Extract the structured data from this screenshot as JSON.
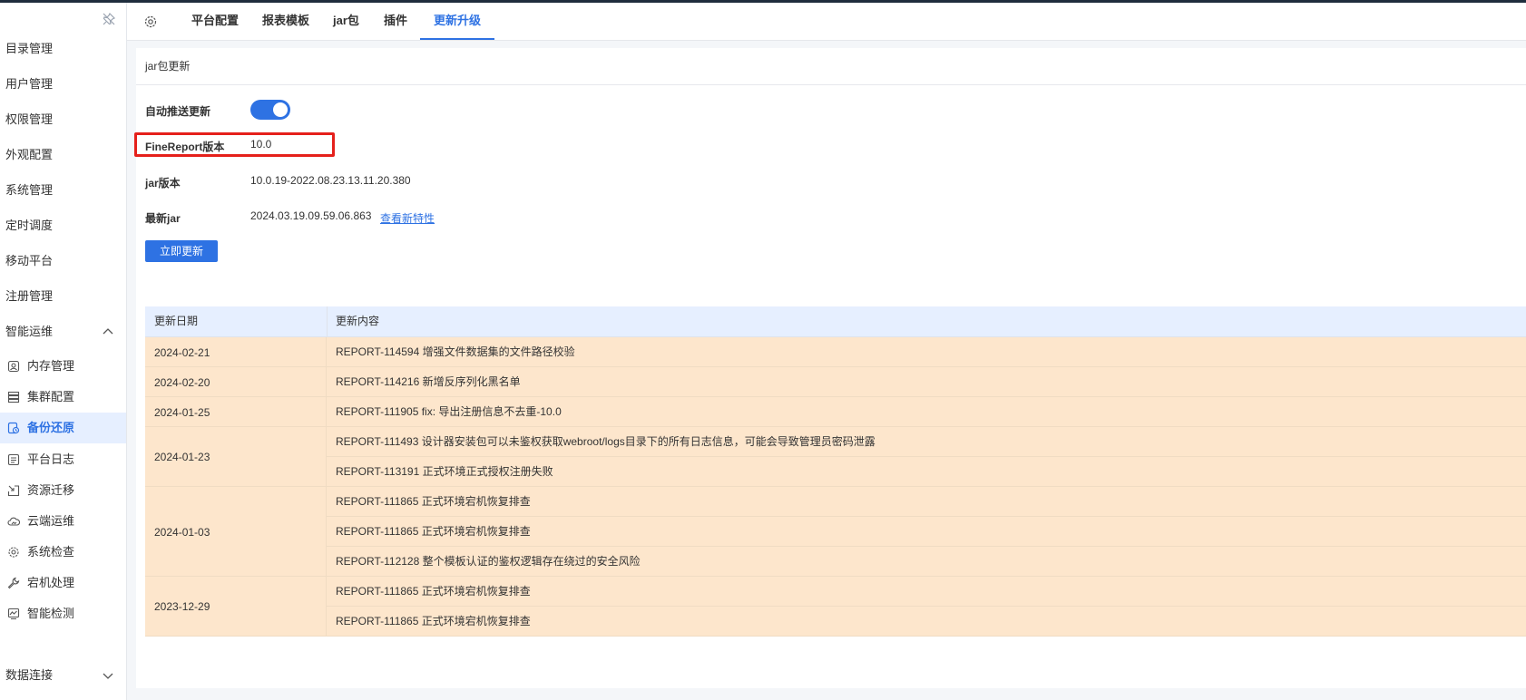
{
  "sidebar": {
    "items": [
      {
        "label": "目录管理"
      },
      {
        "label": "用户管理"
      },
      {
        "label": "权限管理"
      },
      {
        "label": "外观配置"
      },
      {
        "label": "系统管理"
      },
      {
        "label": "定时调度"
      },
      {
        "label": "移动平台"
      },
      {
        "label": "注册管理"
      },
      {
        "label": "智能运维"
      }
    ],
    "sub_items": [
      {
        "label": "内存管理",
        "icon": "memory-icon"
      },
      {
        "label": "集群配置",
        "icon": "cluster-icon"
      },
      {
        "label": "备份还原",
        "icon": "backup-icon",
        "active": true
      },
      {
        "label": "平台日志",
        "icon": "log-icon"
      },
      {
        "label": "资源迁移",
        "icon": "migrate-icon"
      },
      {
        "label": "云端运维",
        "icon": "cloud-icon"
      },
      {
        "label": "系统检查",
        "icon": "check-gear-icon"
      },
      {
        "label": "宕机处理",
        "icon": "wrench-icon"
      },
      {
        "label": "智能检测",
        "icon": "monitor-icon"
      }
    ],
    "last_item": {
      "label": "数据连接"
    }
  },
  "tabs": [
    {
      "label": "平台配置"
    },
    {
      "label": "报表模板"
    },
    {
      "label": "jar包"
    },
    {
      "label": "插件"
    },
    {
      "label": "更新升级",
      "active": true
    }
  ],
  "section": {
    "title": "jar包更新"
  },
  "fields": {
    "auto_push": {
      "label": "自动推送更新",
      "enabled": true
    },
    "fr_version": {
      "label": "FineReport版本",
      "value": "10.0"
    },
    "jar_version": {
      "label": "jar版本",
      "value": "10.0.19-2022.08.23.13.11.20.380"
    },
    "latest_jar": {
      "label": "最新jar",
      "value": "2024.03.19.09.59.06.863",
      "link": "查看新特性"
    }
  },
  "update_button": "立即更新",
  "table": {
    "headers": [
      "更新日期",
      "更新内容"
    ],
    "groups": [
      {
        "date": "2024-02-21",
        "items": [
          "REPORT-114594 增强文件数据集的文件路径校验"
        ]
      },
      {
        "date": "2024-02-20",
        "items": [
          "REPORT-114216 新增反序列化黑名单"
        ]
      },
      {
        "date": "2024-01-25",
        "items": [
          "REPORT-111905 fix: 导出注册信息不去重-10.0"
        ]
      },
      {
        "date": "2024-01-23",
        "items": [
          "REPORT-111493 设计器安装包可以未鉴权获取webroot/logs目录下的所有日志信息，可能会导致管理员密码泄露",
          "REPORT-113191 正式环境正式授权注册失败"
        ]
      },
      {
        "date": "2024-01-03",
        "items": [
          "REPORT-111865 正式环境宕机恢复排查",
          "REPORT-111865 正式环境宕机恢复排查",
          "REPORT-112128 整个模板认证的鉴权逻辑存在绕过的安全风险"
        ]
      },
      {
        "date": "2023-12-29",
        "items": [
          "REPORT-111865 正式环境宕机恢复排查",
          "REPORT-111865 正式环境宕机恢复排查"
        ]
      }
    ]
  },
  "colors": {
    "accent": "#2e72e3",
    "row_bg": "#fde6cc",
    "header_bg": "#e6efff",
    "highlight_border": "#e5201b"
  }
}
